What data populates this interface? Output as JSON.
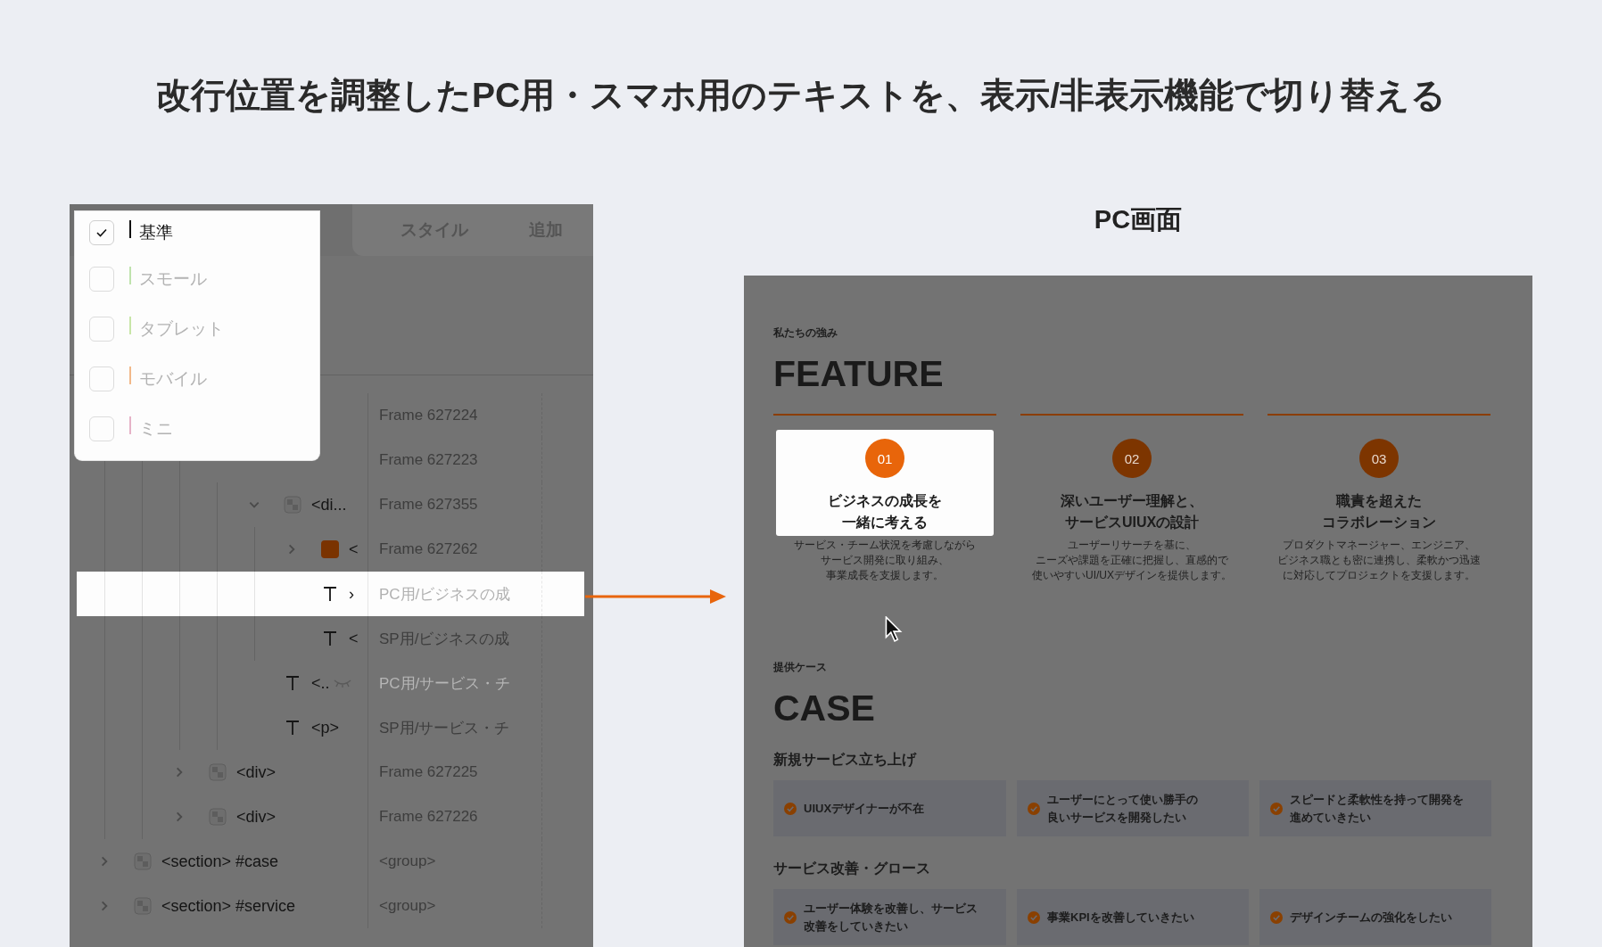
{
  "title": "改行位置を調整したPC用・スマホ用のテキストを、表示/非表示機能で切り替える",
  "editor": {
    "tabs": [
      {
        "label": "スタイル",
        "selected": false
      },
      {
        "label": "追加",
        "selected": false
      }
    ],
    "breakpoints": [
      {
        "label": "基準",
        "checked": true,
        "color": "#111111"
      },
      {
        "label": "スモール",
        "checked": false,
        "color": "#bfe3ad"
      },
      {
        "label": "タブレット",
        "checked": false,
        "color": "#c8e6a8"
      },
      {
        "label": "モバイル",
        "checked": false,
        "color": "#f2b98a"
      },
      {
        "label": "ミニ",
        "checked": false,
        "color": "#e6b3c8"
      }
    ],
    "layers": [
      {
        "children": [
          {
            "children": [
              {
                "children": [
                  {
                    "layer": "Frame 627224",
                    "selected": false,
                    "hidden": false
                  },
                  {
                    "layer": "Frame 627223",
                    "selected": false,
                    "hidden": false,
                    "children": [
                      {
                        "kind": "frame",
                        "name": "<di...",
                        "layer": "Frame 627355",
                        "expanded": true,
                        "selected": false,
                        "hidden": false,
                        "children": [
                          {
                            "kind": "fill",
                            "color": "#7a3300",
                            "name": "<",
                            "layer": "Frame 627262",
                            "expanded": false,
                            "selected": false,
                            "hidden": false
                          },
                          {
                            "kind": "text",
                            "name": "›",
                            "layer": "PC用/ビジネスの成",
                            "selected": true,
                            "hidden": true
                          },
                          {
                            "kind": "text",
                            "name": "<",
                            "layer": "SP用/ビジネスの成",
                            "selected": false,
                            "hidden": false
                          }
                        ]
                      },
                      {
                        "kind": "text",
                        "name": "<..",
                        "layer": "PC用/サービス・チ",
                        "selected": false,
                        "hidden": true,
                        "hovered": true
                      },
                      {
                        "kind": "text",
                        "name": "<p>",
                        "layer": "SP用/サービス・チ",
                        "selected": false,
                        "hidden": false
                      }
                    ]
                  }
                ]
              },
              {
                "kind": "frame",
                "name": "<div>",
                "layer": "Frame 627225",
                "expanded": false,
                "selected": false,
                "hidden": false
              },
              {
                "kind": "frame",
                "name": "<div>",
                "layer": "Frame 627226",
                "expanded": false,
                "selected": false,
                "hidden": false
              }
            ]
          }
        ]
      },
      {
        "kind": "frame",
        "name": "<section> #case",
        "layer": "<group>",
        "expanded": false,
        "selected": false,
        "hidden": false
      },
      {
        "kind": "frame",
        "name": "<section> #service",
        "layer": "<group>",
        "expanded": false,
        "selected": false,
        "hidden": false
      }
    ]
  },
  "preview": {
    "heading": "PC画面",
    "feature": {
      "eyebrow": "私たちの強み",
      "heading": "FEATURE",
      "cards": [
        {
          "number": "01",
          "title": [
            "ビジネスの成長を",
            "一緒に考える"
          ],
          "description": [
            "サービス・チーム状況を考慮しながら",
            "サービス開発に取り組み、",
            "事業成長を支援します。"
          ],
          "highlighted": true
        },
        {
          "number": "02",
          "title": [
            "深いユーザー理解と、",
            "サービスUIUXの設計"
          ],
          "description": [
            "ユーザーリサーチを基に、",
            "ニーズや課題を正確に把握し、直感的で",
            "使いやすいUI/UXデザインを提供します。"
          ],
          "highlighted": false
        },
        {
          "number": "03",
          "title": [
            "職責を超えた",
            "コラボレーション"
          ],
          "description": [
            "プロダクトマネージャー、エンジニア、",
            "ビジネス職とも密に連携し、柔軟かつ迅速",
            "に対応してプロジェクトを支援します。"
          ],
          "highlighted": false
        }
      ]
    },
    "case": {
      "eyebrow": "提供ケース",
      "heading": "CASE",
      "groups": [
        {
          "title": "新規サービス立ち上げ",
          "items": [
            [
              "UIUXデザイナーが不在"
            ],
            [
              "ユーザーにとって使い勝手の",
              "良いサービスを開発したい"
            ],
            [
              "スピードと柔軟性を持って開発を",
              "進めていきたい"
            ]
          ]
        },
        {
          "title": "サービス改善・グロース",
          "items": [
            [
              "ユーザー体験を改善し、サービス",
              "改善をしていきたい"
            ],
            [
              "事業KPIを改善していきたい"
            ],
            [
              "デザインチームの強化をしたい"
            ]
          ]
        }
      ]
    }
  }
}
